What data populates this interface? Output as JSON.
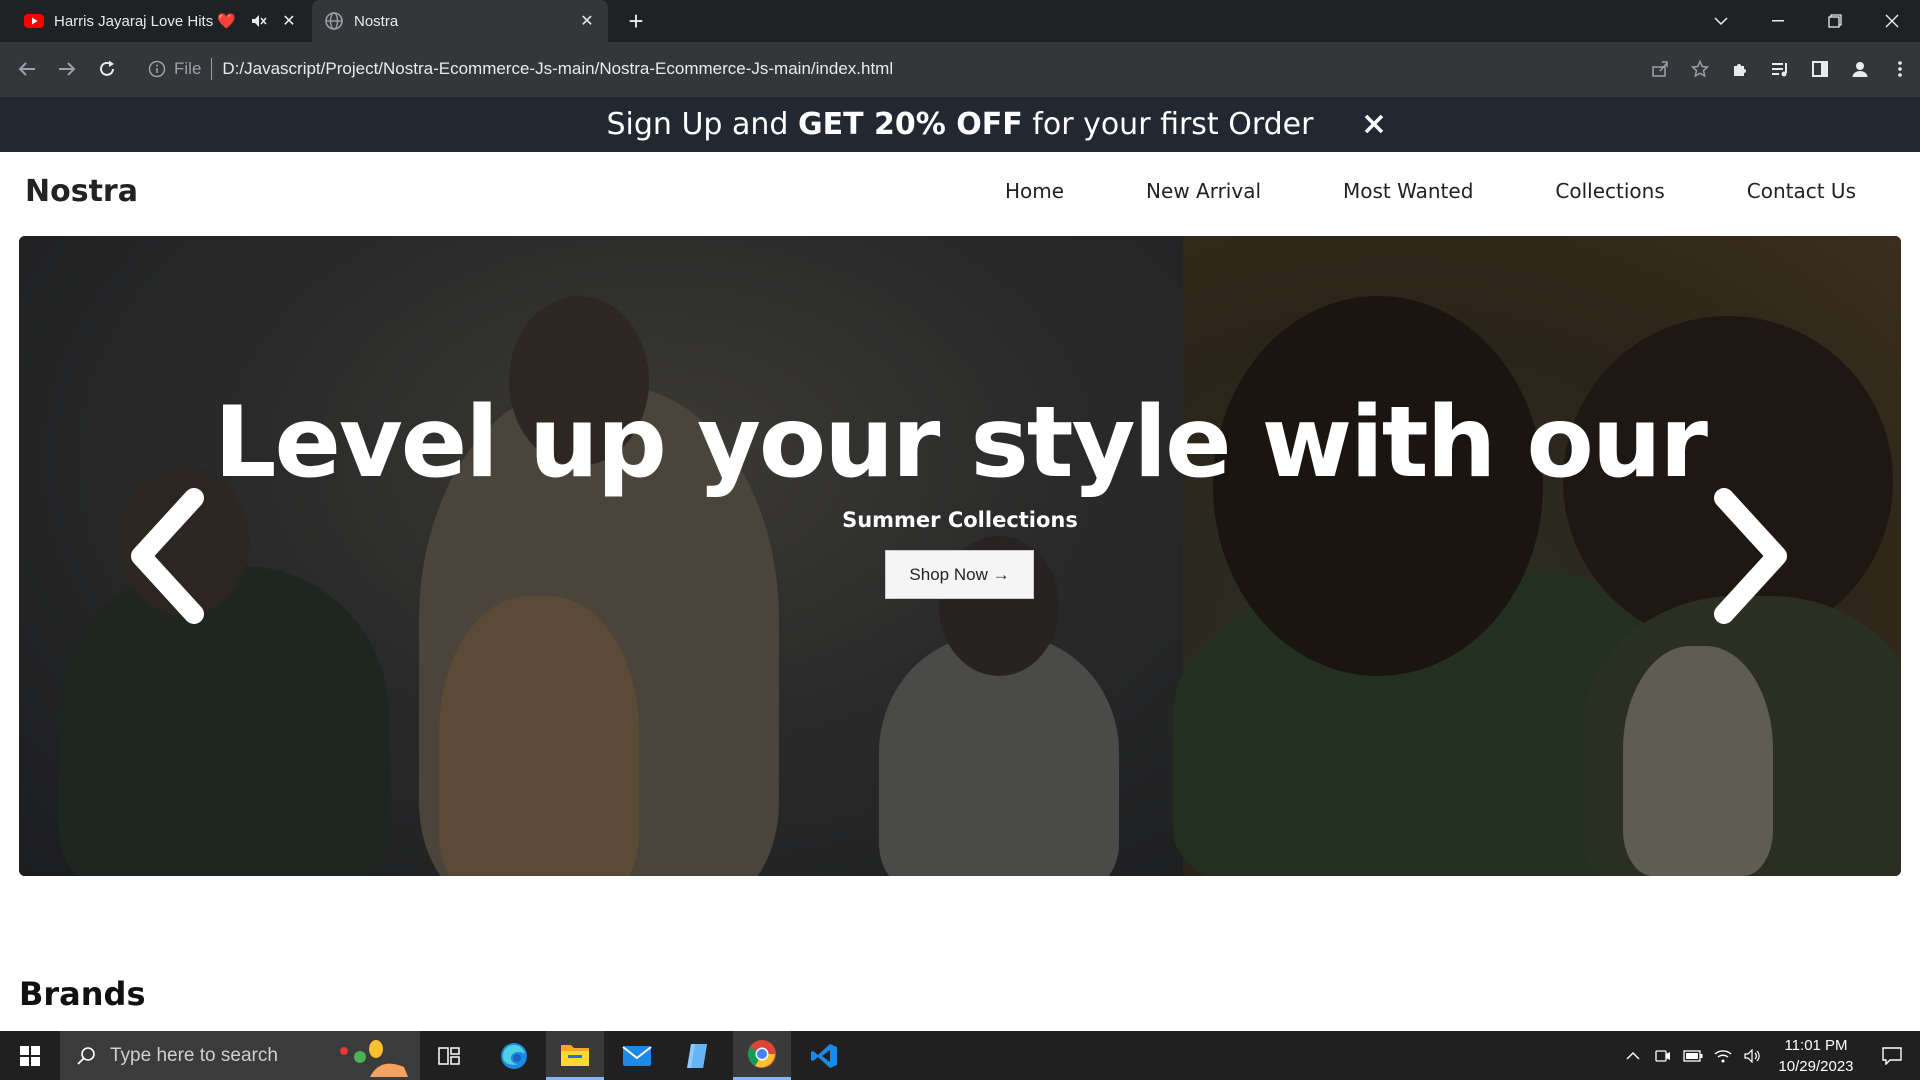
{
  "browser": {
    "tabs": [
      {
        "title": "Harris Jayaraj Love Hits ❤️",
        "icon": "youtube-icon",
        "audio": "muted-speaker-icon"
      },
      {
        "title": "Nostra",
        "icon": "globe-icon"
      }
    ],
    "address": {
      "scheme": "File",
      "url": "D:/Javascript/Project/Nostra-Ecommerce-Js-main/Nostra-Ecommerce-Js-main/index.html"
    }
  },
  "promo": {
    "pre": "Sign Up and ",
    "bold": "GET 20% OFF",
    "post": " for your first Order",
    "close": "✕"
  },
  "nav": {
    "logo": "Nostra",
    "links": [
      "Home",
      "New Arrival",
      "Most Wanted",
      "Collections",
      "Contact Us"
    ]
  },
  "hero": {
    "headline": "Level up your style with our",
    "subline": "Summer Collections",
    "button": "Shop Now →"
  },
  "sections": {
    "brands_title": "Brands"
  },
  "taskbar": {
    "search_placeholder": "Type here to search",
    "time": "11:01 PM",
    "date": "10/29/2023"
  },
  "colors": {
    "promo_bg": "#222831",
    "browser_bg": "#202124",
    "toolbar_bg": "#35363a",
    "taskbar_bg": "#202020"
  }
}
